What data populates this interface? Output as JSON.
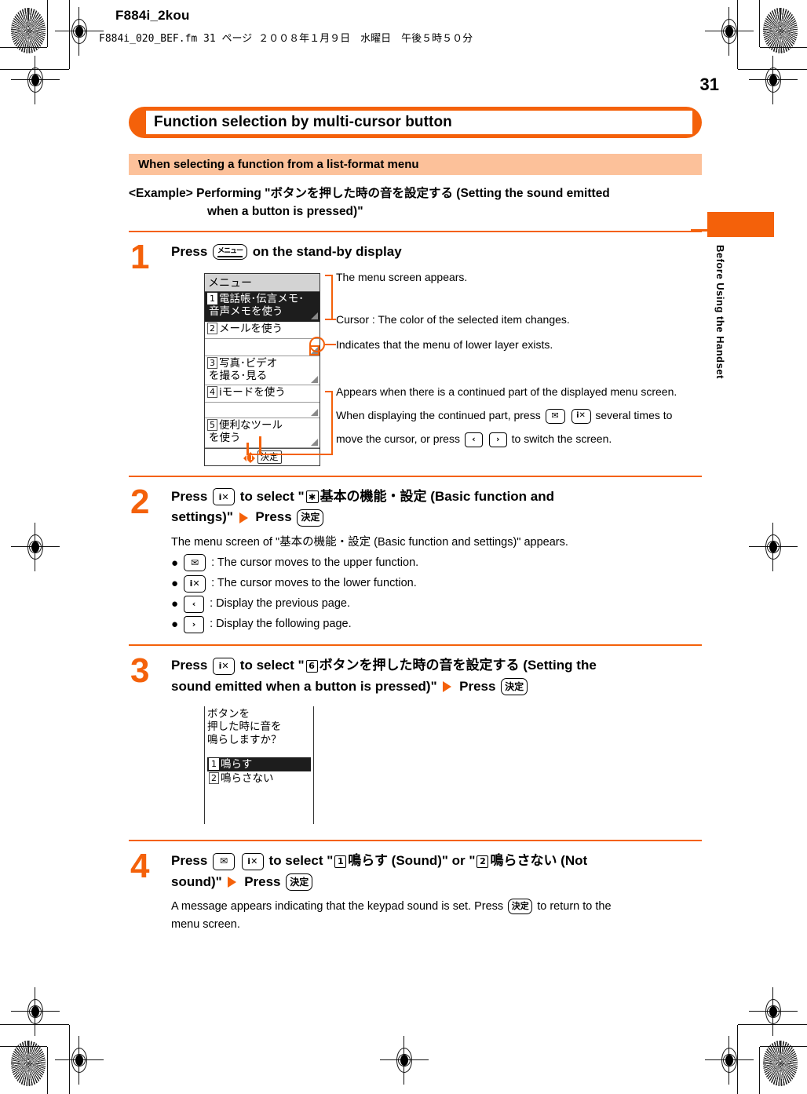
{
  "print_header": {
    "title": "F884i_2kou",
    "file_line": "F884i_020_BEF.fm  31 ページ  ２００８年１月９日　水曜日　午後５時５０分"
  },
  "page_number": "31",
  "side_tab_label": "Before Using the Handset",
  "banner": {
    "title": "Function selection by multi-cursor button"
  },
  "subheading": "When selecting a function from a list-format menu",
  "example": {
    "label": "<Example>",
    "line1": "Performing \"ボタンを押した時の音を設定する (Setting the sound emitted",
    "line2": "when a button is pressed)\""
  },
  "keys": {
    "menu": "メニュー",
    "ok": "決定",
    "imode": "i✕",
    "mail": "✉",
    "prev": "‹",
    "next": "›",
    "asterisk": "✱",
    "six": "6",
    "one": "1",
    "two": "2"
  },
  "steps": [
    {
      "number": "1",
      "title_before_key": "Press",
      "title_after_key": "on the stand-by display",
      "screen": {
        "title": "メニュー",
        "rows": [
          {
            "num": "1",
            "lines": [
              "電話帳･伝言メモ･",
              "音声メモを使う"
            ],
            "selected": true,
            "corner": true
          },
          {
            "num": "2",
            "lines": [
              "メールを使う"
            ],
            "selected": false,
            "corner": false
          },
          {
            "num": "",
            "lines": [
              ""
            ],
            "selected": false,
            "corner": true,
            "highlight_corner": true
          },
          {
            "num": "3",
            "lines": [
              "写真･ビデオ",
              "を撮る･見る"
            ],
            "selected": false,
            "corner": true
          },
          {
            "num": "4",
            "lines": [
              "iモードを使う"
            ],
            "selected": false,
            "corner": false
          },
          {
            "num": "",
            "lines": [
              ""
            ],
            "selected": false,
            "corner": true
          },
          {
            "num": "5",
            "lines": [
              "便利なツール",
              "を使う"
            ],
            "selected": false,
            "corner": true
          }
        ],
        "footer_key": "決定"
      },
      "annotations": [
        {
          "text": "The menu screen appears."
        },
        {
          "text": "Cursor : The color of the selected item changes."
        },
        {
          "text": "Indicates that the menu of lower layer exists."
        },
        {
          "text": "Appears when there is a continued part of the displayed menu screen."
        },
        {
          "text_a": "When displaying the continued part, press",
          "text_b": "several times to"
        },
        {
          "text_a": "move the cursor, or press",
          "text_b": "to switch the screen."
        }
      ]
    },
    {
      "number": "2",
      "title_part1": "Press",
      "title_part2": "to select \"",
      "title_jp": "基本の機能・設定 (Basic function and",
      "title_part3": "settings)\"",
      "title_press": "Press",
      "body": "The menu screen of \"基本の機能・設定 (Basic function and settings)\" appears.",
      "bullets": [
        {
          "key": "mail",
          "text": ": The cursor moves to the upper function."
        },
        {
          "key": "imode",
          "text": ": The cursor moves to the lower function."
        },
        {
          "key": "prev",
          "text": ": Display the previous page."
        },
        {
          "key": "next",
          "text": ": Display the following page."
        }
      ]
    },
    {
      "number": "3",
      "title_part1": "Press",
      "title_part2": "to select \"",
      "title_jp": "ボタンを押した時の音を設定する (Setting the",
      "title_part3": "sound emitted when a button is pressed)\"",
      "title_press": "Press",
      "screen": {
        "message": [
          "ボタンを",
          "押した時に音を",
          "鳴らしますか？"
        ],
        "rows": [
          {
            "num": "1",
            "label": "鳴らす",
            "selected": true
          },
          {
            "num": "2",
            "label": "鳴らさない",
            "selected": false
          }
        ]
      }
    },
    {
      "number": "4",
      "title_part1": "Press",
      "title_part2": "to select \"",
      "title_jp_a": "鳴らす (Sound)\" or \"",
      "title_jp_b": "鳴らさない (Not",
      "title_part3": "sound)\"",
      "title_press": "Press",
      "body_a": "A message appears indicating that the keypad sound is set. Press",
      "body_b": "to return to the",
      "body_c": "menu screen."
    }
  ],
  "colors": {
    "accent": "#f4610a",
    "subbar": "#fcc19a",
    "screen_header": "#d3d3d3",
    "selected_row": "#1d1d1d"
  }
}
